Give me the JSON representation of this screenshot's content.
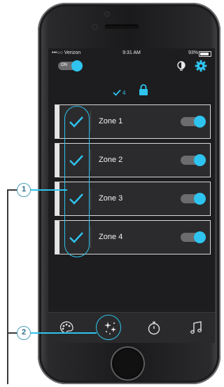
{
  "status_bar": {
    "carrier": "•••○○ Verizon",
    "time": "9:31 AM",
    "battery": "93%"
  },
  "master_toggle": {
    "label": "ON",
    "on": true
  },
  "lock_row": {
    "count": "4"
  },
  "zones": [
    {
      "name": "Zone 1",
      "checked": true,
      "on": true
    },
    {
      "name": "Zone 2",
      "checked": true,
      "on": true
    },
    {
      "name": "Zone 3",
      "checked": true,
      "on": true
    },
    {
      "name": "Zone 4",
      "checked": true,
      "on": true
    }
  ],
  "tabs": [
    {
      "icon": "palette-icon"
    },
    {
      "icon": "effects-sparkle-icon",
      "selected": true
    },
    {
      "icon": "timer-icon"
    },
    {
      "icon": "music-note-icon"
    }
  ],
  "callouts": {
    "one": "1",
    "two": "2"
  },
  "colors": {
    "accent": "#2ec4ef",
    "screen_bg": "#1d1d1f",
    "card_border": "#d7d7d7",
    "callout": "#4aa0b8"
  }
}
